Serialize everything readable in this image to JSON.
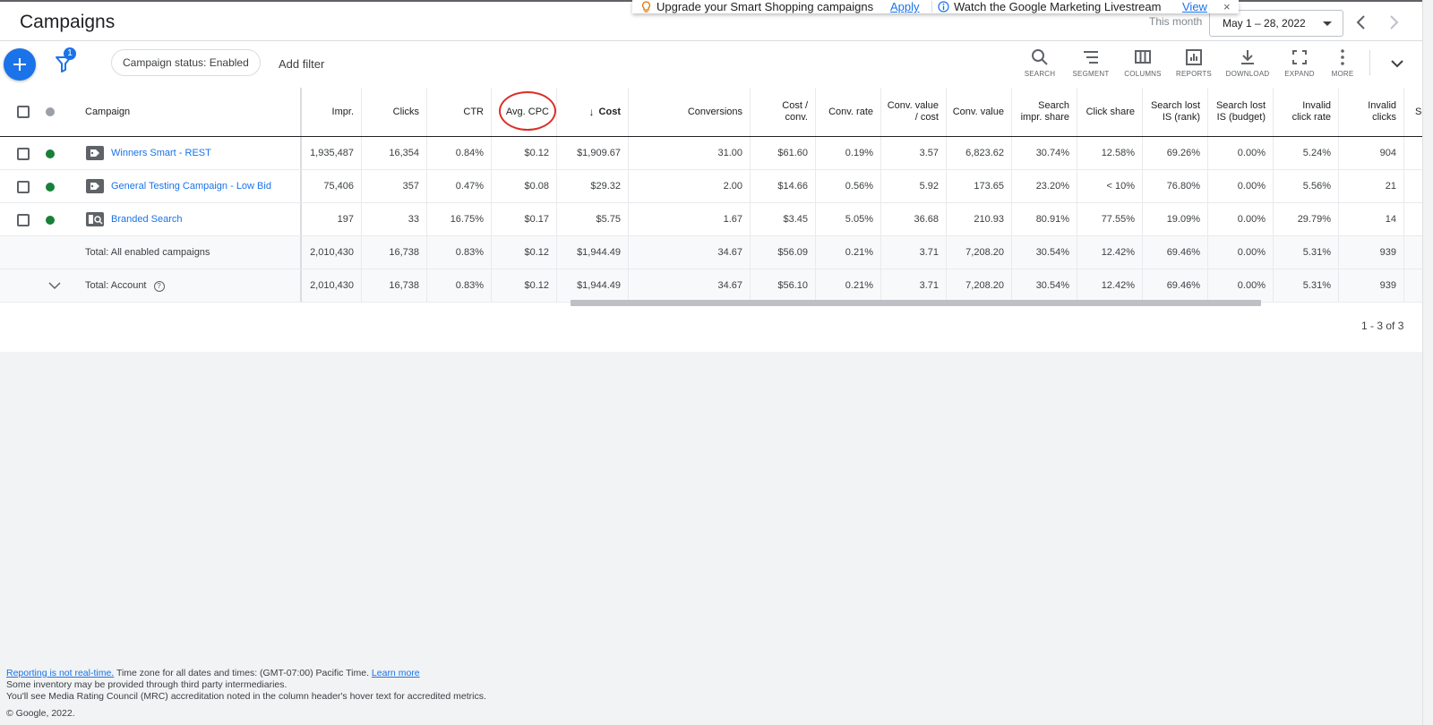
{
  "header": {
    "title": "Campaigns",
    "date_label": "This month",
    "date_range": "May 1 – 28, 2022"
  },
  "banner": {
    "upgrade_text": "Upgrade your Smart Shopping campaigns",
    "upgrade_link": "Apply",
    "watch_text": "Watch the Google Marketing Livestream",
    "watch_link": "View",
    "close": "×"
  },
  "toolbar": {
    "filter_badge": "1",
    "chip": "Campaign status: Enabled",
    "add_filter": "Add filter",
    "tools": [
      "SEARCH",
      "SEGMENT",
      "COLUMNS",
      "REPORTS",
      "DOWNLOAD",
      "EXPAND",
      "MORE"
    ]
  },
  "table": {
    "headers": {
      "campaign": "Campaign",
      "impr": "Impr.",
      "clicks": "Clicks",
      "ctr": "CTR",
      "avg_cpc": "Avg. CPC",
      "cost": "Cost",
      "conversions": "Conversions",
      "cost_conv_1": "Cost /",
      "cost_conv_2": "conv.",
      "conv_rate": "Conv. rate",
      "conv_value_cost_1": "Conv. value",
      "conv_value_cost_2": "/ cost",
      "conv_value": "Conv. value",
      "search_impr_1": "Search",
      "search_impr_2": "impr. share",
      "click_share": "Click share",
      "lost_rank_1": "Search lost",
      "lost_rank_2": "IS (rank)",
      "lost_budget_1": "Search lost",
      "lost_budget_2": "IS (budget)",
      "invalid_rate_1": "Invalid",
      "invalid_rate_2": "click rate",
      "invalid_clicks_1": "Invalid",
      "invalid_clicks_2": "clicks",
      "overflow": "Se"
    },
    "rows": [
      {
        "name": "Winners Smart - REST",
        "impr": "1,935,487",
        "clicks": "16,354",
        "ctr": "0.84%",
        "avg_cpc": "$0.12",
        "cost": "$1,909.67",
        "conversions": "31.00",
        "cost_conv": "$61.60",
        "conv_rate": "0.19%",
        "conv_value_cost": "3.57",
        "conv_value": "6,823.62",
        "search_impr": "30.74%",
        "click_share": "12.58%",
        "lost_rank": "69.26%",
        "lost_budget": "0.00%",
        "invalid_rate": "5.24%",
        "invalid_clicks": "904"
      },
      {
        "name": "General Testing Campaign - Low Bid",
        "impr": "75,406",
        "clicks": "357",
        "ctr": "0.47%",
        "avg_cpc": "$0.08",
        "cost": "$29.32",
        "conversions": "2.00",
        "cost_conv": "$14.66",
        "conv_rate": "0.56%",
        "conv_value_cost": "5.92",
        "conv_value": "173.65",
        "search_impr": "23.20%",
        "click_share": "< 10%",
        "lost_rank": "76.80%",
        "lost_budget": "0.00%",
        "invalid_rate": "5.56%",
        "invalid_clicks": "21"
      },
      {
        "name": "Branded Search",
        "impr": "197",
        "clicks": "33",
        "ctr": "16.75%",
        "avg_cpc": "$0.17",
        "cost": "$5.75",
        "conversions": "1.67",
        "cost_conv": "$3.45",
        "conv_rate": "5.05%",
        "conv_value_cost": "36.68",
        "conv_value": "210.93",
        "search_impr": "80.91%",
        "click_share": "77.55%",
        "lost_rank": "19.09%",
        "lost_budget": "0.00%",
        "invalid_rate": "29.79%",
        "invalid_clicks": "14"
      }
    ],
    "totals": [
      {
        "label": "Total: All enabled campaigns",
        "impr": "2,010,430",
        "clicks": "16,738",
        "ctr": "0.83%",
        "avg_cpc": "$0.12",
        "cost": "$1,944.49",
        "conversions": "34.67",
        "cost_conv": "$56.09",
        "conv_rate": "0.21%",
        "conv_value_cost": "3.71",
        "conv_value": "7,208.20",
        "search_impr": "30.54%",
        "click_share": "12.42%",
        "lost_rank": "69.46%",
        "lost_budget": "0.00%",
        "invalid_rate": "5.31%",
        "invalid_clicks": "939"
      },
      {
        "label": "Total: Account",
        "impr": "2,010,430",
        "clicks": "16,738",
        "ctr": "0.83%",
        "avg_cpc": "$0.12",
        "cost": "$1,944.49",
        "conversions": "34.67",
        "cost_conv": "$56.10",
        "conv_rate": "0.21%",
        "conv_value_cost": "3.71",
        "conv_value": "7,208.20",
        "search_impr": "30.54%",
        "click_share": "12.42%",
        "lost_rank": "69.46%",
        "lost_budget": "0.00%",
        "invalid_rate": "5.31%",
        "invalid_clicks": "939"
      }
    ],
    "pagination": "1 - 3 of 3"
  },
  "footer": {
    "reporting_link": "Reporting is not real-time.",
    "timezone_text": " Time zone for all dates and times: (GMT-07:00) Pacific Time. ",
    "learn_more": "Learn more",
    "line2": "Some inventory may be provided through third party intermediaries.",
    "line3": "You'll see Media Rating Council (MRC) accreditation noted in the column header's hover text for accredited metrics.",
    "copyright": "© Google, 2022."
  },
  "colors": {
    "accent": "#1a73e8",
    "status_enabled": "#188038",
    "status_header": "#9aa0a6",
    "annotation": "#d93025"
  }
}
